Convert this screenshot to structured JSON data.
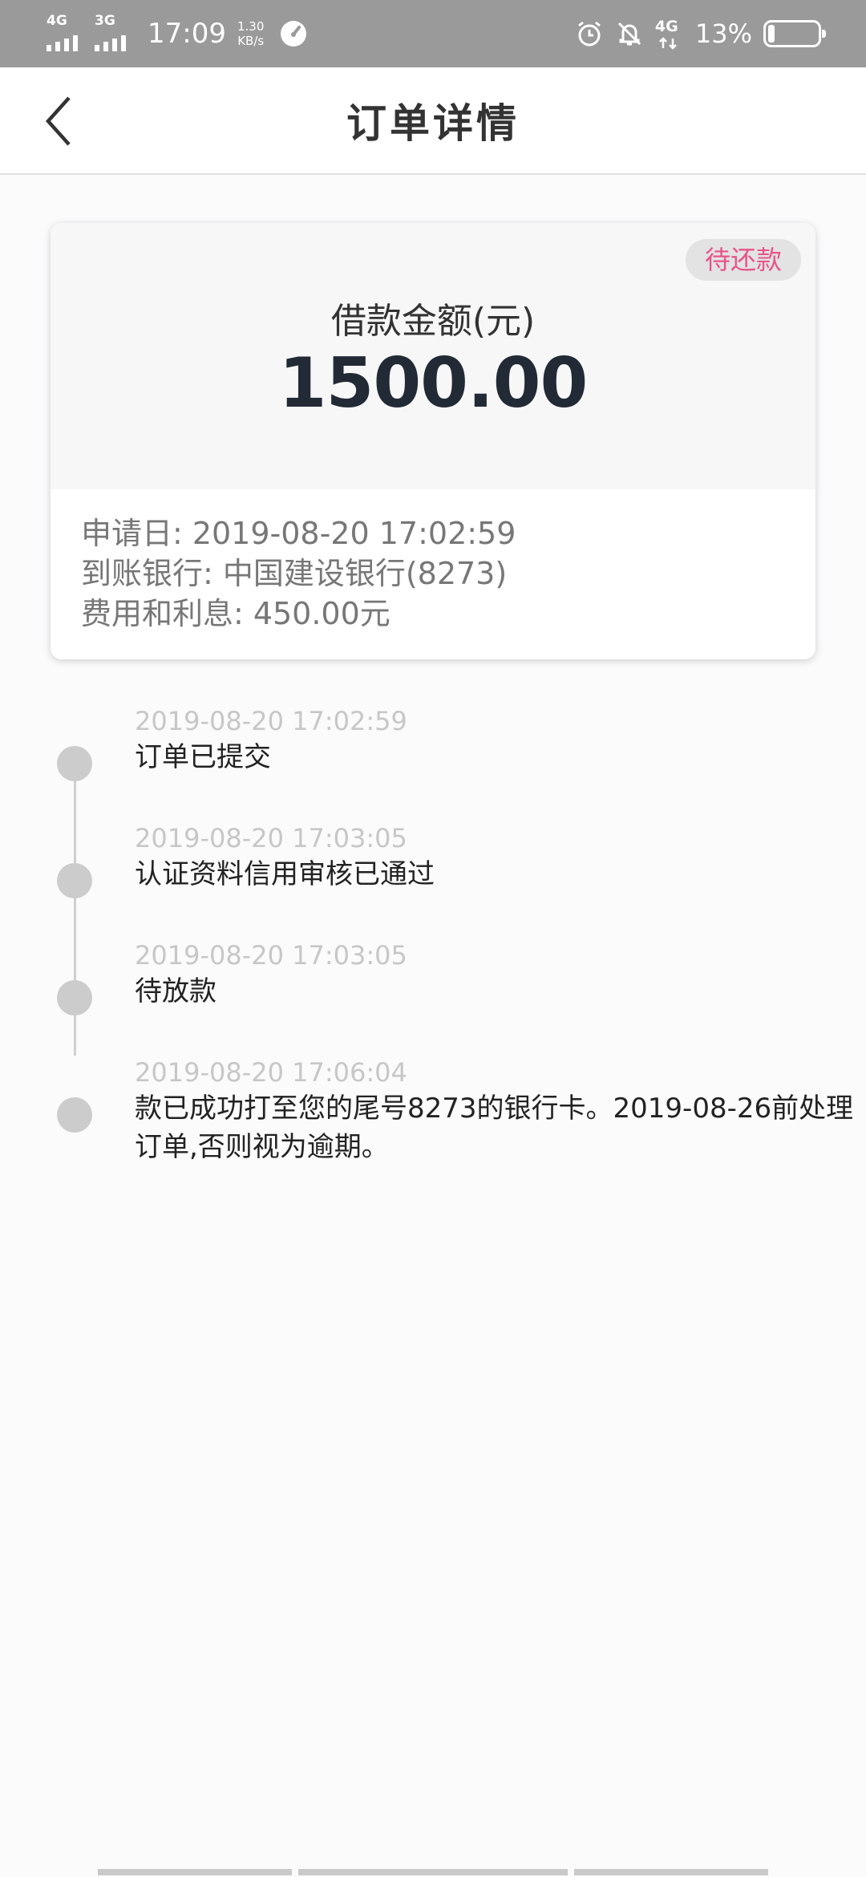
{
  "status_bar": {
    "net1": "4G",
    "net2": "3G",
    "time": "17:09",
    "speed_value": "1.30",
    "speed_unit": "KB/s",
    "net3": "4G",
    "battery_pct": "13%",
    "battery_level": 0.13
  },
  "nav": {
    "title": "订单详情"
  },
  "card": {
    "status_badge": "待还款",
    "amount_label": "借款金额(元)",
    "amount_value": "1500.00",
    "apply_date_label": "申请日:",
    "apply_date_value": "2019-08-20 17:02:59",
    "bank_label": "到账银行:",
    "bank_value": "中国建设银行(8273)",
    "fee_label": "费用和利息:",
    "fee_value": "450.00元"
  },
  "timeline": [
    {
      "time": "2019-08-20 17:02:59",
      "text": "订单已提交"
    },
    {
      "time": "2019-08-20 17:03:05",
      "text": "认证资料信用审核已通过"
    },
    {
      "time": "2019-08-20 17:03:05",
      "text": "待放款"
    },
    {
      "time": "2019-08-20 17:06:04",
      "text": "款已成功打至您的尾号8273的银行卡。2019-08-26前处理订单,否则视为逾期。"
    }
  ],
  "colors": {
    "accent_pink": "#e8548a",
    "status_bar": "#9a9a9a"
  }
}
